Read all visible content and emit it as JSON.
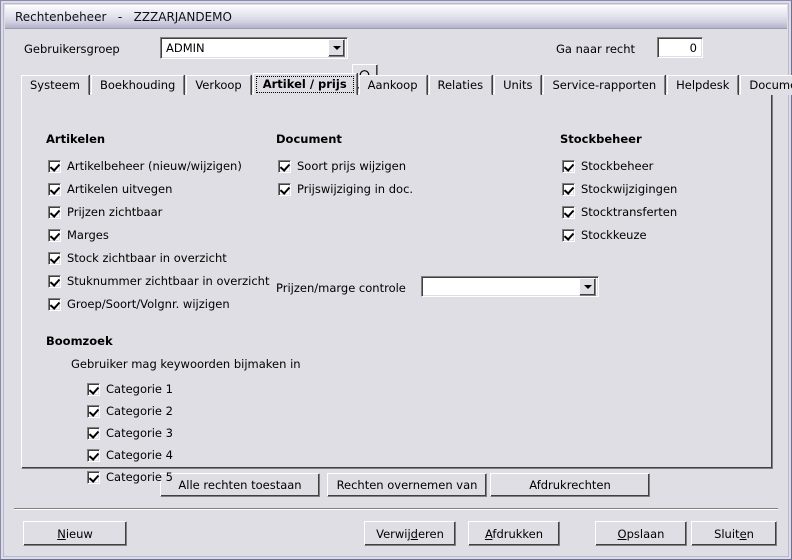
{
  "window": {
    "title": "Rechtenbeheer   -   ZZZARJANDEMO"
  },
  "toolbar": {
    "group_label": "Gebruikersgroep",
    "group_value": "ADMIN",
    "search_icon": "magnifier-icon",
    "goto_label": "Ga naar recht",
    "goto_value": "0"
  },
  "tabs": [
    {
      "label": "Systeem",
      "active": false
    },
    {
      "label": "Boekhouding",
      "active": false
    },
    {
      "label": "Verkoop",
      "active": false
    },
    {
      "label": "Artikel / prijs",
      "active": true
    },
    {
      "label": "Aankoop",
      "active": false
    },
    {
      "label": "Relaties",
      "active": false
    },
    {
      "label": "Units",
      "active": false
    },
    {
      "label": "Service-rapporten",
      "active": false
    },
    {
      "label": "Helpdesk",
      "active": false
    },
    {
      "label": "Documenten",
      "active": false
    }
  ],
  "groups": {
    "artikelen": {
      "title": "Artikelen",
      "items": [
        {
          "label": "Artikelbeheer (nieuw/wijzigen)",
          "checked": true
        },
        {
          "label": "Artikelen uitvegen",
          "checked": true
        },
        {
          "label": "Prijzen zichtbaar",
          "checked": true
        },
        {
          "label": "Marges",
          "checked": true
        },
        {
          "label": "Stock zichtbaar in overzicht",
          "checked": true
        },
        {
          "label": "Stuknummer zichtbaar in overzicht",
          "checked": true
        },
        {
          "label": "Groep/Soort/Volgnr. wijzigen",
          "checked": true
        }
      ]
    },
    "document": {
      "title": "Document",
      "items": [
        {
          "label": "Soort prijs wijzigen",
          "checked": true
        },
        {
          "label": "Prijswijziging in doc.",
          "checked": true
        }
      ],
      "marge_label": "Prijzen/marge controle",
      "marge_value": ""
    },
    "stockbeheer": {
      "title": "Stockbeheer",
      "items": [
        {
          "label": "Stockbeheer",
          "checked": true
        },
        {
          "label": "Stockwijzigingen",
          "checked": true
        },
        {
          "label": "Stocktransferten",
          "checked": true
        },
        {
          "label": "Stockkeuze",
          "checked": true
        }
      ]
    },
    "boomzoek": {
      "title": "Boomzoek",
      "subtitle": "Gebruiker mag keywoorden bijmaken in",
      "items": [
        {
          "label": "Categorie 1",
          "checked": true
        },
        {
          "label": "Categorie 2",
          "checked": true
        },
        {
          "label": "Categorie 3",
          "checked": true
        },
        {
          "label": "Categorie 4",
          "checked": true
        },
        {
          "label": "Categorie 5",
          "checked": true
        }
      ]
    }
  },
  "actions": {
    "allow_all": "Alle rechten toestaan",
    "copy_from": "Rechten overnemen van",
    "print_rights": "Afdrukrechten"
  },
  "footer": {
    "new": {
      "pre": "",
      "acc": "N",
      "post": "ieuw"
    },
    "delete": {
      "pre": "Verwij",
      "acc": "d",
      "post": "eren"
    },
    "print": {
      "pre": "",
      "acc": "A",
      "post": "fdrukken"
    },
    "save": {
      "pre": "",
      "acc": "O",
      "post": "pslaan"
    },
    "close": {
      "pre": "Sluit",
      "acc": "e",
      "post": "n"
    }
  },
  "colors": {
    "face": "#dedee4",
    "titlebar_light": "#ffffff",
    "titlebar_dark": "#b3b3cc",
    "field": "#ffffff",
    "border_dark": "#404040",
    "text": "#000000"
  }
}
